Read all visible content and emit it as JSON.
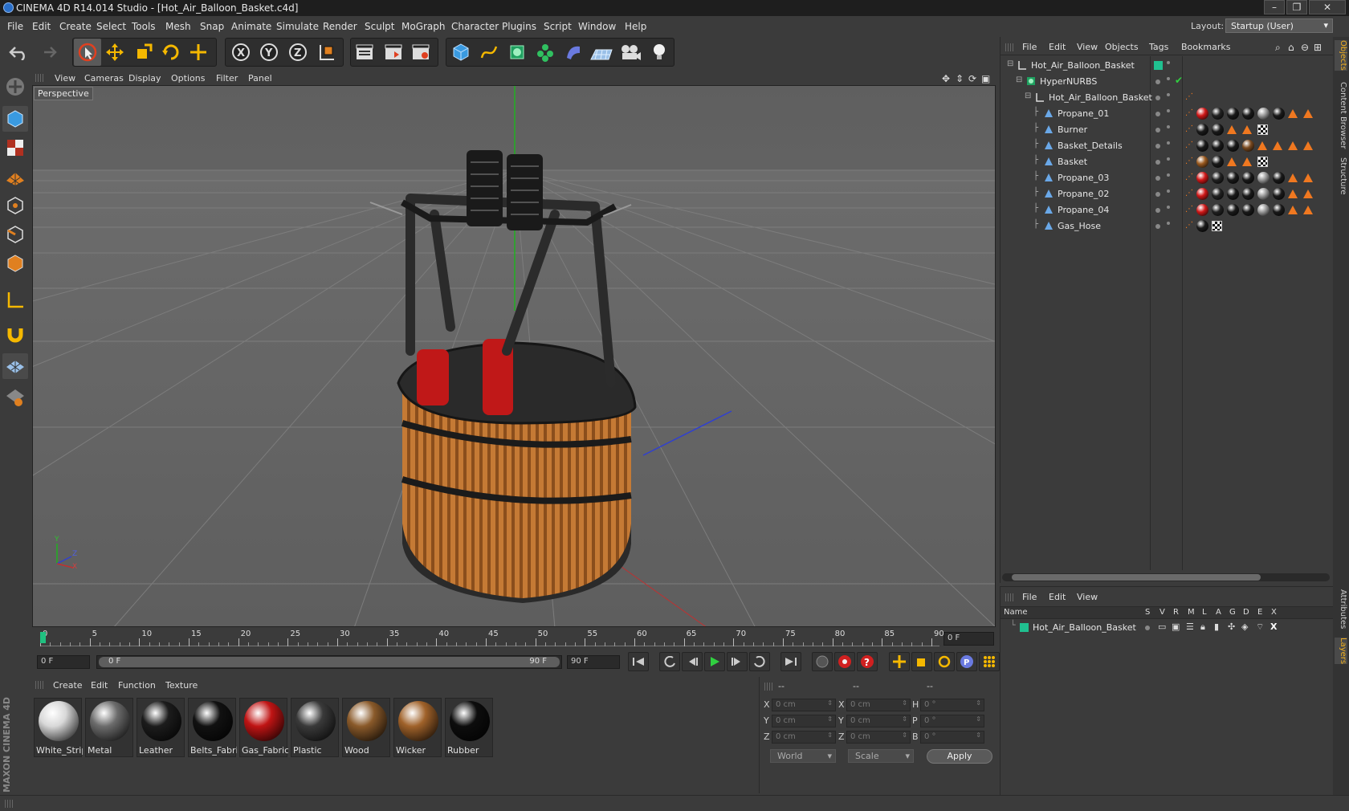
{
  "title": "CINEMA 4D R14.014 Studio - [Hot_Air_Balloon_Basket.c4d]",
  "menus": [
    "File",
    "Edit",
    "Create",
    "Select",
    "Tools",
    "Mesh",
    "Snap",
    "Animate",
    "Simulate",
    "Render",
    "Sculpt",
    "MoGraph",
    "Character",
    "Plugins",
    "Script",
    "Window",
    "Help"
  ],
  "layout": {
    "label": "Layout:",
    "value": "Startup (User)"
  },
  "viewport": {
    "menus": [
      "View",
      "Cameras",
      "Display",
      "Options",
      "Filter",
      "Panel"
    ],
    "label": "Perspective",
    "axis": {
      "x": "X",
      "y": "Y",
      "z": "Z"
    }
  },
  "timeline": {
    "ticks": [
      "0",
      "5",
      "10",
      "15",
      "20",
      "25",
      "30",
      "35",
      "40",
      "45",
      "50",
      "55",
      "60",
      "65",
      "70",
      "75",
      "80",
      "85",
      "90"
    ],
    "current": "0 F",
    "start": "0 F",
    "range_start": "0 F",
    "range_end": "90 F",
    "end": "90 F"
  },
  "materials": {
    "menus": [
      "Create",
      "Edit",
      "Function",
      "Texture"
    ],
    "items": [
      {
        "name": "White_Strip",
        "color": "#d8d8d8"
      },
      {
        "name": "Metal",
        "color": "#6c6c6c"
      },
      {
        "name": "Leather",
        "color": "#1c1c1c"
      },
      {
        "name": "Belts_Fabric",
        "color": "#111111"
      },
      {
        "name": "Gas_Fabric",
        "color": "#c01414"
      },
      {
        "name": "Plastic",
        "color": "#3a3a3a"
      },
      {
        "name": "Wood",
        "color": "#8a5a2a"
      },
      {
        "name": "Wicker",
        "color": "#a0622a"
      },
      {
        "name": "Rubber",
        "color": "#0d0d0d"
      }
    ]
  },
  "coords": {
    "headers": [
      "--",
      "--",
      "--"
    ],
    "rows": [
      {
        "a": "X",
        "av": "0 cm",
        "b": "X",
        "bv": "0 cm",
        "c": "H",
        "cv": "0 °"
      },
      {
        "a": "Y",
        "av": "0 cm",
        "b": "Y",
        "bv": "0 cm",
        "c": "P",
        "cv": "0 °"
      },
      {
        "a": "Z",
        "av": "0 cm",
        "b": "Z",
        "bv": "0 cm",
        "c": "B",
        "cv": "0 °"
      }
    ],
    "space": "World",
    "mode": "Scale",
    "apply": "Apply"
  },
  "objects": {
    "menus": [
      "File",
      "Edit",
      "View",
      "Objects",
      "Tags",
      "Bookmarks"
    ],
    "items": [
      {
        "name": "Hot_Air_Balloon_Basket",
        "indent": 0,
        "type": "null"
      },
      {
        "name": "HyperNURBS",
        "indent": 1,
        "type": "nurbs"
      },
      {
        "name": "Hot_Air_Balloon_Basket",
        "indent": 2,
        "type": "null"
      },
      {
        "name": "Propane_01",
        "indent": 3,
        "type": "poly"
      },
      {
        "name": "Burner",
        "indent": 3,
        "type": "poly"
      },
      {
        "name": "Basket_Details",
        "indent": 3,
        "type": "poly"
      },
      {
        "name": "Basket",
        "indent": 3,
        "type": "poly"
      },
      {
        "name": "Propane_03",
        "indent": 3,
        "type": "poly"
      },
      {
        "name": "Propane_02",
        "indent": 3,
        "type": "poly"
      },
      {
        "name": "Propane_04",
        "indent": 3,
        "type": "poly"
      },
      {
        "name": "Gas_Hose",
        "indent": 3,
        "type": "poly"
      }
    ]
  },
  "layers": {
    "menus": [
      "File",
      "Edit",
      "View"
    ],
    "columns": [
      "Name",
      "S",
      "V",
      "R",
      "M",
      "L",
      "A",
      "G",
      "D",
      "E",
      "X"
    ],
    "items": [
      {
        "name": "Hot_Air_Balloon_Basket",
        "color": "#20c090"
      }
    ]
  },
  "sidetabs": [
    "Objects",
    "Content Browser",
    "Structure",
    "Attributes",
    "Layers"
  ],
  "brand": "MAXON CINEMA 4D"
}
